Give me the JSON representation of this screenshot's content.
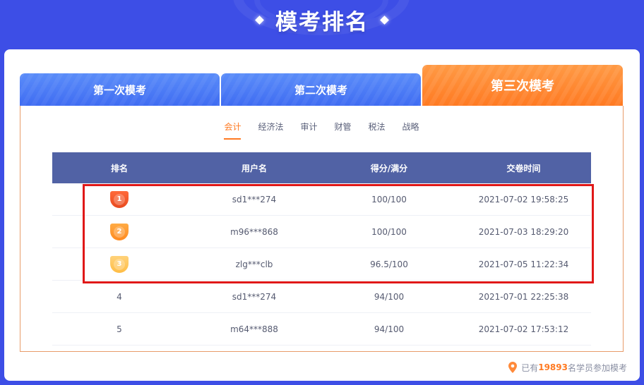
{
  "header": {
    "title": "模考排名"
  },
  "tabs": [
    {
      "label": "第一次模考",
      "active": false
    },
    {
      "label": "第二次模考",
      "active": false
    },
    {
      "label": "第三次模考",
      "active": true
    }
  ],
  "subjects": [
    {
      "label": "会计",
      "active": true
    },
    {
      "label": "经济法",
      "active": false
    },
    {
      "label": "审计",
      "active": false
    },
    {
      "label": "财管",
      "active": false
    },
    {
      "label": "税法",
      "active": false
    },
    {
      "label": "战略",
      "active": false
    }
  ],
  "table": {
    "headers": [
      "排名",
      "用户名",
      "得分/满分",
      "交卷时间"
    ],
    "rows": [
      {
        "rank": "1",
        "user": "sd1***274",
        "score": "100/100",
        "time": "2021-07-02 19:58:25"
      },
      {
        "rank": "2",
        "user": "m96***868",
        "score": "100/100",
        "time": "2021-07-03 18:29:20"
      },
      {
        "rank": "3",
        "user": "zlg***clb",
        "score": "96.5/100",
        "time": "2021-07-05 11:22:34"
      },
      {
        "rank": "4",
        "user": "sd1***274",
        "score": "94/100",
        "time": "2021-07-01 22:25:38"
      },
      {
        "rank": "5",
        "user": "m64***888",
        "score": "94/100",
        "time": "2021-07-02 17:53:12"
      }
    ]
  },
  "footer": {
    "prefix": "已有",
    "count": "19893",
    "suffix": "名学员参加模考"
  },
  "colors": {
    "accent": "#ff7a22",
    "tab_blue": "#4a7bf5",
    "table_header": "#5162a5",
    "highlight": "#e01818"
  }
}
